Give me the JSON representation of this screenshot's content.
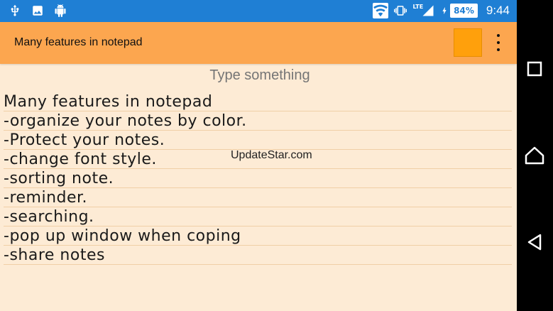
{
  "status_bar": {
    "icons_left": [
      "usb-icon",
      "image-icon",
      "android-icon"
    ],
    "icons_right": [
      "wifi-icon",
      "vibrate-icon",
      "signal-icon",
      "charging-icon"
    ],
    "network": "LTE",
    "battery": "84%",
    "time": "9:44"
  },
  "app_bar": {
    "title": "Many features in notepad",
    "color_swatch": "#ffa00c",
    "menu_icon": "more-vert-icon"
  },
  "note": {
    "title_placeholder": "Type something",
    "lines": [
      "Many features in notepad",
      "-organize your notes by color.",
      "-Protect your notes.",
      "-change font style.",
      "-sorting note.",
      "-reminder.",
      "-searching.",
      "-pop up window when coping",
      "-share notes"
    ]
  },
  "watermark": "UpdateStar.com",
  "nav_bar": [
    "recents-icon",
    "home-icon",
    "back-icon"
  ],
  "colors": {
    "status_bar": "#1f7fd4",
    "app_bar": "#fca64f",
    "paper": "#fdebd5"
  }
}
